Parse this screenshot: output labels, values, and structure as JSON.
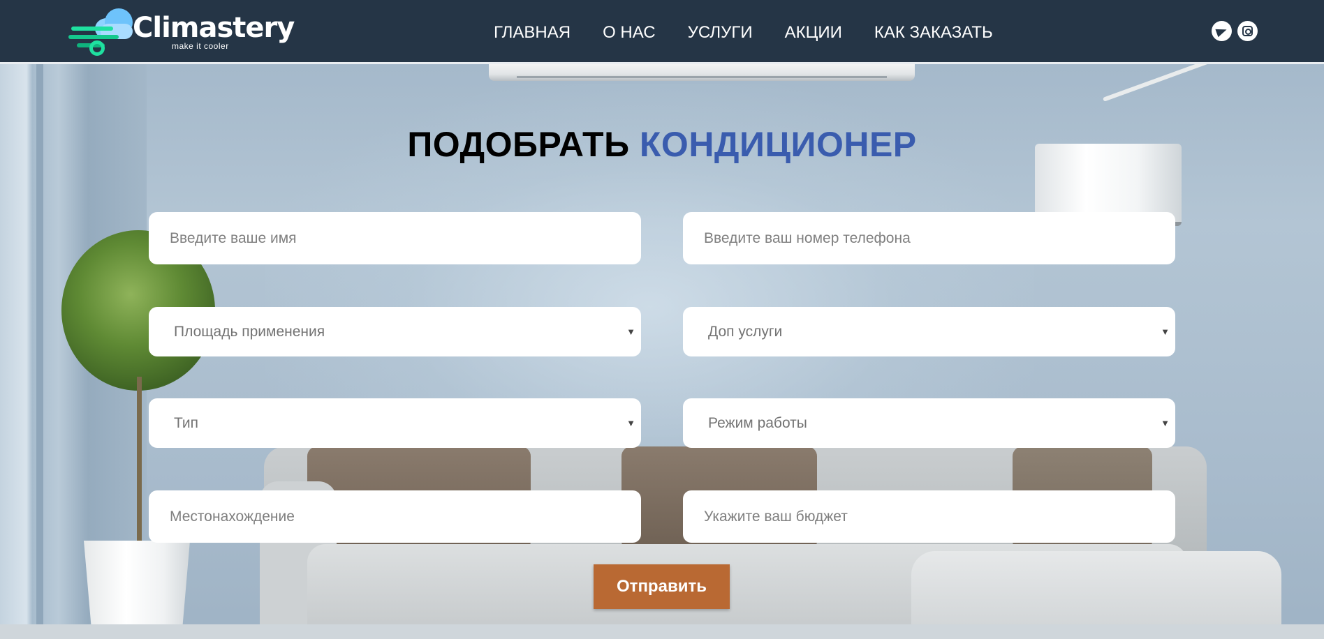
{
  "brand": {
    "name": "Climastery",
    "tagline": "make it cooler"
  },
  "nav": {
    "items": [
      {
        "label": "ГЛАВНАЯ"
      },
      {
        "label": "О НАС"
      },
      {
        "label": "УСЛУГИ"
      },
      {
        "label": "АКЦИИ"
      },
      {
        "label": "КАК ЗАКАЗАТЬ"
      }
    ]
  },
  "social": {
    "icons": [
      "telegram-icon",
      "instagram-icon"
    ]
  },
  "form": {
    "title_part1": "ПОДОБРАТЬ",
    "title_part2": "КОНДИЦИОНЕР",
    "name_placeholder": "Введите ваше имя",
    "phone_placeholder": "Введите ваш номер телефона",
    "area_select": "Площадь применения",
    "extra_services_select": "Доп услуги",
    "type_select": "Тип",
    "mode_select": "Режим работы",
    "location_placeholder": "Местонахождение",
    "budget_placeholder": "Укажите ваш бюджет",
    "select_arrow": "▼",
    "submit_label": "Отправить"
  },
  "colors": {
    "header_bg": "#253546",
    "title_accent": "#3a5cae",
    "submit_bg": "#b96933"
  }
}
